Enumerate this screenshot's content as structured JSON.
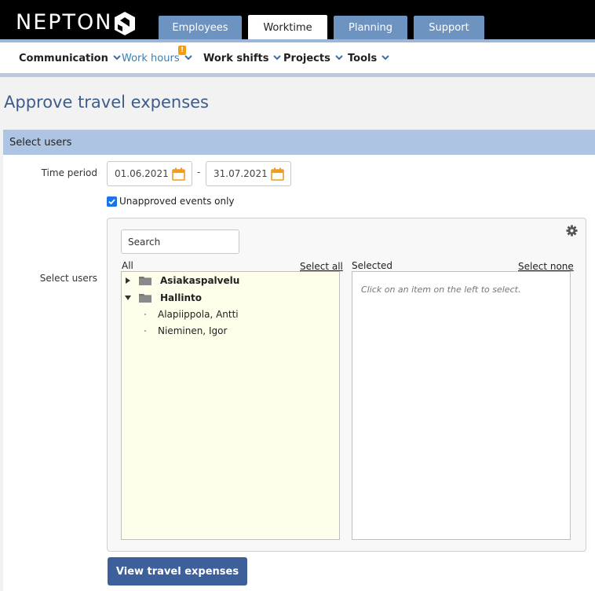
{
  "brand": {
    "name": "NEPTON"
  },
  "tabs": [
    {
      "label": "Employees"
    },
    {
      "label": "Worktime"
    },
    {
      "label": "Planning"
    },
    {
      "label": "Support"
    }
  ],
  "nav": {
    "items": [
      {
        "label": "Communication"
      },
      {
        "label": "Work hours",
        "badge": "!"
      },
      {
        "label": "Work shifts"
      },
      {
        "label": "Projects"
      },
      {
        "label": "Tools"
      }
    ]
  },
  "page": {
    "title": "Approve travel expenses"
  },
  "section": {
    "title": "Select users"
  },
  "form": {
    "time_period_label": "Time period",
    "date_from": "01.06.2021",
    "date_to": "31.07.2021",
    "separator": "-",
    "unapproved_label": "Unapproved events only",
    "unapproved_checked": true,
    "select_users_label": "Select users",
    "search_placeholder": "Search",
    "all_label": "All",
    "select_all": "Select all",
    "selected_label": "Selected",
    "select_none": "Select none",
    "empty_hint": "Click on an item on the left to select.",
    "tree": [
      {
        "label": "Asiakaspalvelu",
        "expanded": false
      },
      {
        "label": "Hallinto",
        "expanded": true,
        "children": [
          "Alapiippola, Antti",
          "Nieminen, Igor"
        ]
      }
    ],
    "submit_label": "View travel expenses"
  },
  "colors": {
    "accent": "#3e609a",
    "tab": "#6d93c1",
    "section": "#adc5e3",
    "title": "#3e5c89",
    "badge": "#f39c12",
    "list_bg": "#fefeea"
  }
}
